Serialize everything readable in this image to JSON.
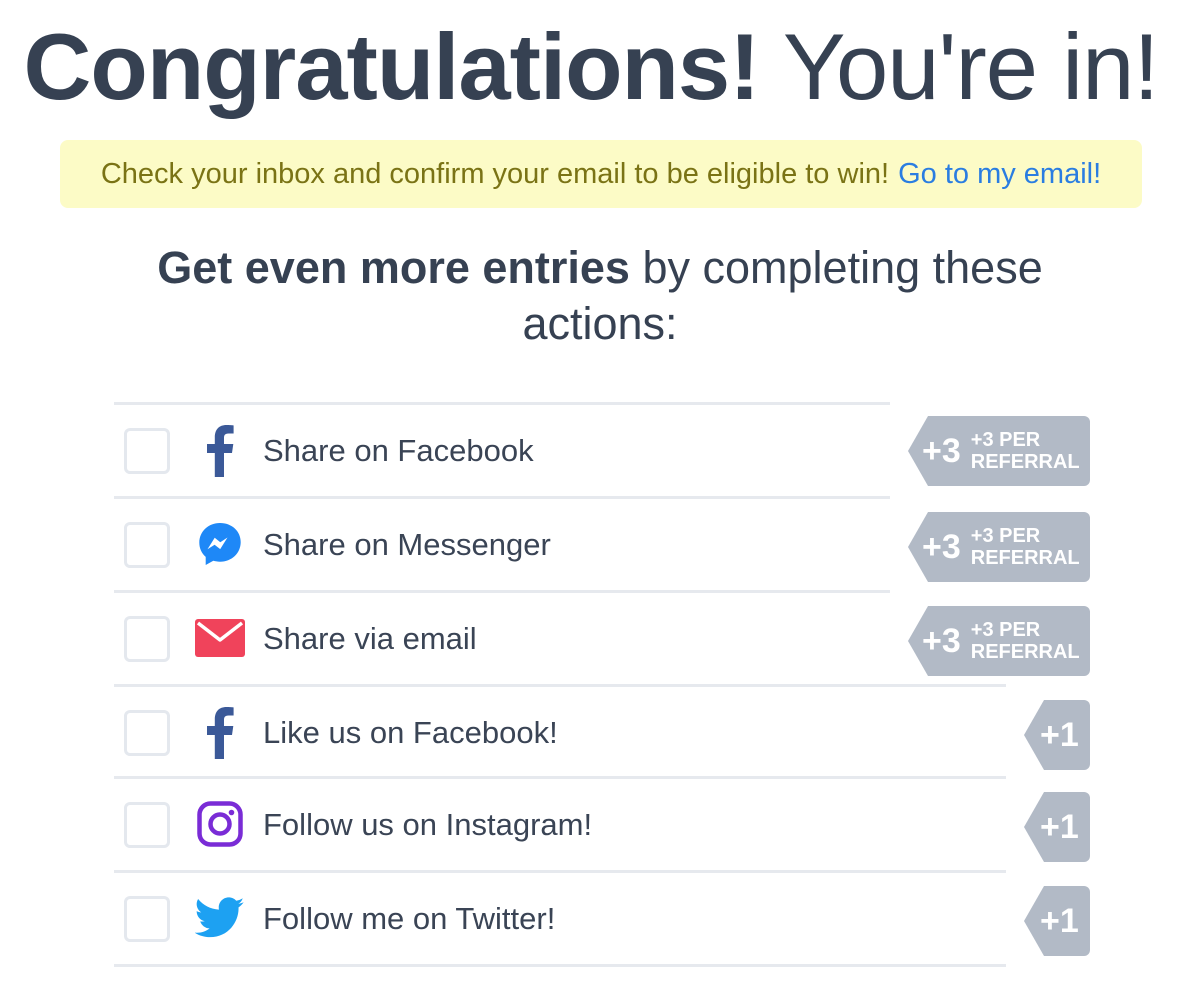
{
  "header": {
    "title_strong": "Congratulations!",
    "title_light": "You're in!"
  },
  "notice": {
    "message": "Check your inbox and confirm your email to be eligible to win!",
    "link": "Go to my email!"
  },
  "subhead": {
    "strong": "Get even more entries",
    "light": "by completing these actions:"
  },
  "actions": [
    {
      "label": "Share on Facebook",
      "icon": "facebook-icon",
      "points": "+3",
      "per_line1": "+3 PER",
      "per_line2": "REFERRAL",
      "checked": false
    },
    {
      "label": "Share on Messenger",
      "icon": "messenger-icon",
      "points": "+3",
      "per_line1": "+3 PER",
      "per_line2": "REFERRAL",
      "checked": false
    },
    {
      "label": "Share via email",
      "icon": "envelope-icon",
      "points": "+3",
      "per_line1": "+3 PER",
      "per_line2": "REFERRAL",
      "checked": false
    },
    {
      "label": "Like us on Facebook!",
      "icon": "facebook-icon",
      "points": "+1",
      "checked": false
    },
    {
      "label": "Follow us on Instagram!",
      "icon": "instagram-icon",
      "points": "+1",
      "checked": false
    },
    {
      "label": "Follow me on Twitter!",
      "icon": "twitter-icon",
      "points": "+1",
      "checked": false
    }
  ],
  "colors": {
    "text": "#364152",
    "notice_bg": "#fcfbc6",
    "notice_text": "#7a7315",
    "link": "#2a7de1",
    "badge": "#b2bac6",
    "facebook": "#3b5998",
    "messenger": "#1e88f7",
    "email": "#f0435b",
    "instagram": "#7a2cd6",
    "twitter": "#1da1f2"
  }
}
